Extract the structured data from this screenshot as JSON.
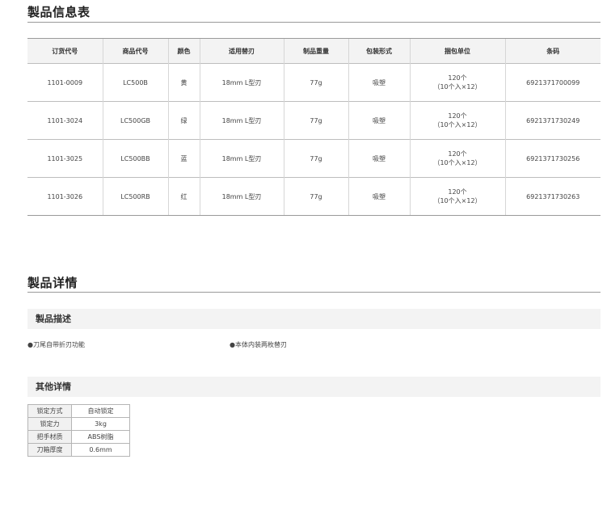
{
  "spec_section": {
    "title": "製品信息表",
    "headers": [
      "订货代号",
      "商品代号",
      "颜色",
      "适用替刃",
      "制品重量",
      "包装形式",
      "捆包单位",
      "条码"
    ],
    "rows": [
      {
        "order_code": "1101-0009",
        "product_code": "LC500B",
        "color": "黄",
        "blade": "18mm L型刃",
        "weight": "77g",
        "packaging": "吸塑",
        "unit_line1": "120个",
        "unit_line2": "（10个入×12）",
        "barcode": "6921371700099"
      },
      {
        "order_code": "1101-3024",
        "product_code": "LC500GB",
        "color": "绿",
        "blade": "18mm L型刃",
        "weight": "77g",
        "packaging": "吸塑",
        "unit_line1": "120个",
        "unit_line2": "（10个入×12）",
        "barcode": "6921371730249"
      },
      {
        "order_code": "1101-3025",
        "product_code": "LC500BB",
        "color": "蓝",
        "blade": "18mm L型刃",
        "weight": "77g",
        "packaging": "吸塑",
        "unit_line1": "120个",
        "unit_line2": "（10个入×12）",
        "barcode": "6921371730256"
      },
      {
        "order_code": "1101-3026",
        "product_code": "LC500RB",
        "color": "红",
        "blade": "18mm L型刃",
        "weight": "77g",
        "packaging": "吸塑",
        "unit_line1": "120个",
        "unit_line2": "（10个入×12）",
        "barcode": "6921371730263"
      }
    ]
  },
  "detail_section": {
    "title": "製品详情",
    "description": {
      "heading": "製品描述",
      "bullets": [
        "●刀尾自带折刃功能",
        "●本体内装两枚替刃"
      ]
    },
    "other": {
      "heading": "其他详情",
      "props": [
        {
          "key": "锁定方式",
          "value": "自动锁定"
        },
        {
          "key": "锁定力",
          "value": "3kg"
        },
        {
          "key": "把手材质",
          "value": "ABS树脂"
        },
        {
          "key": "刀箱厚度",
          "value": "0.6mm"
        }
      ]
    }
  }
}
